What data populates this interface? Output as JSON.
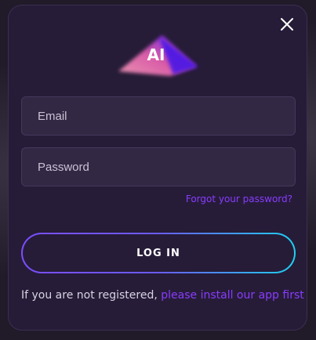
{
  "modal": {
    "logo_text": "AI",
    "email_placeholder": "Email",
    "password_placeholder": "Password",
    "forgot_link": "Forgot your password?",
    "login_button": "LOG IN",
    "register_prefix": "If you are not registered,",
    "register_link": "please install our app first"
  },
  "icons": {
    "close": "close-icon",
    "logo": "ai-logo"
  },
  "colors": {
    "background": "#261c38",
    "field": "#332844",
    "link": "#8a3bff",
    "button_gradient_start": "#7c4dff",
    "button_gradient_end": "#1fd0f2",
    "logo_pink": "#f07aa6",
    "logo_purple": "#6b2bff"
  }
}
